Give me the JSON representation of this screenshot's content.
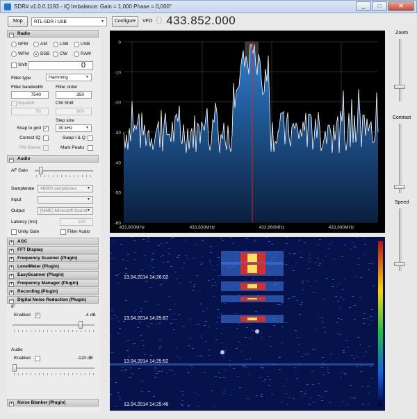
{
  "window": {
    "title": "SDR# v1.0.0.1193 - IQ Imbalance: Gain = 1,000 Phase = 0,000°",
    "controls": [
      "minimize",
      "maximize",
      "close"
    ]
  },
  "toolbar": {
    "stop_label": "Stop",
    "source": "RTL-SDR / USB",
    "configure_label": "Configure",
    "vfo_label": "VFO",
    "vfo_prefix": "0.",
    "vfo_value": "433.852.000"
  },
  "radio": {
    "header": "Radio",
    "modes": [
      {
        "label": "NFM",
        "on": false
      },
      {
        "label": "AM",
        "on": false
      },
      {
        "label": "LSB",
        "on": false
      },
      {
        "label": "USB",
        "on": false
      },
      {
        "label": "WFM",
        "on": false
      },
      {
        "label": "DSB",
        "on": true
      },
      {
        "label": "CW",
        "on": false
      },
      {
        "label": "RAW",
        "on": false
      }
    ],
    "shift_label": "Shift",
    "shift_value": "0",
    "filter_type_label": "Filter type",
    "filter_type": "Hamming",
    "filter_bandwidth_label": "Filter bandwidth",
    "filter_bandwidth": "7540",
    "filter_order_label": "Filter order",
    "filter_order": "350",
    "squelch_label": "Squelch",
    "squelch_value": "50",
    "cw_shift_label": "CW Shift",
    "cw_shift_value": "600",
    "step_size_label": "Step size",
    "step_size": "30 kHz",
    "snap_label": "Snap to grid",
    "correct_iq_label": "Correct IQ",
    "swap_iq_label": "Swap I & Q",
    "fm_stereo_label": "FM Stereo",
    "mark_peaks_label": "Mark Peaks"
  },
  "audio": {
    "header": "Audio",
    "af_gain_label": "AF Gain",
    "samplerate_label": "Samplerate",
    "samplerate": "48000 sample/sec",
    "input_label": "Input",
    "input": "",
    "output_label": "Output",
    "output": "[MME] Microsoft Sound",
    "latency_label": "Latency (ms)",
    "latency": "100",
    "unity_gain_label": "Unity Gain",
    "filter_audio_label": "Filter Audio"
  },
  "plugins": [
    "AGC",
    "FFT Display",
    "Frequency Scanner (Plugin)",
    "LevelMeter (Plugin)",
    "EasyScanner (Plugin)",
    "Frequency Manager (Plugin)",
    "Recording (Plugin)",
    "Digital Noise Reduction (Plugin)"
  ],
  "dnr": {
    "if_label": "IF",
    "if_enabled_label": "Enabled",
    "if_value": "-4 dB",
    "if_level": 0.85,
    "audio_label": "Audio",
    "audio_enabled_label": "Enabled",
    "audio_value": "-120 dB",
    "audio_level": 0.0
  },
  "noise_blanker": "Noise Blanker (Plugin)",
  "spectrum": {
    "db_labels": [
      "0",
      "-10",
      "-20",
      "-30",
      "-40",
      "-50",
      "-60"
    ],
    "freq_labels": [
      "433,800MHz",
      "433,830MHz",
      "433,860MHz",
      "433,890MHz"
    ],
    "colors": {
      "fill_top": "#2f7fd0",
      "fill_bottom": "#0a1f3d",
      "trace": "#ffffff",
      "cursor": "#e0202a"
    }
  },
  "waterfall": {
    "timestamps": [
      "13.04.2014 14:26:02",
      "13.04.2014 14:25:57",
      "13.04.2014 14:25:52",
      "13.04.2014 14:25:46"
    ]
  },
  "side_sliders": {
    "zoom_label": "Zoom",
    "contrast_label": "Contrast",
    "speed_label": "Speed"
  }
}
